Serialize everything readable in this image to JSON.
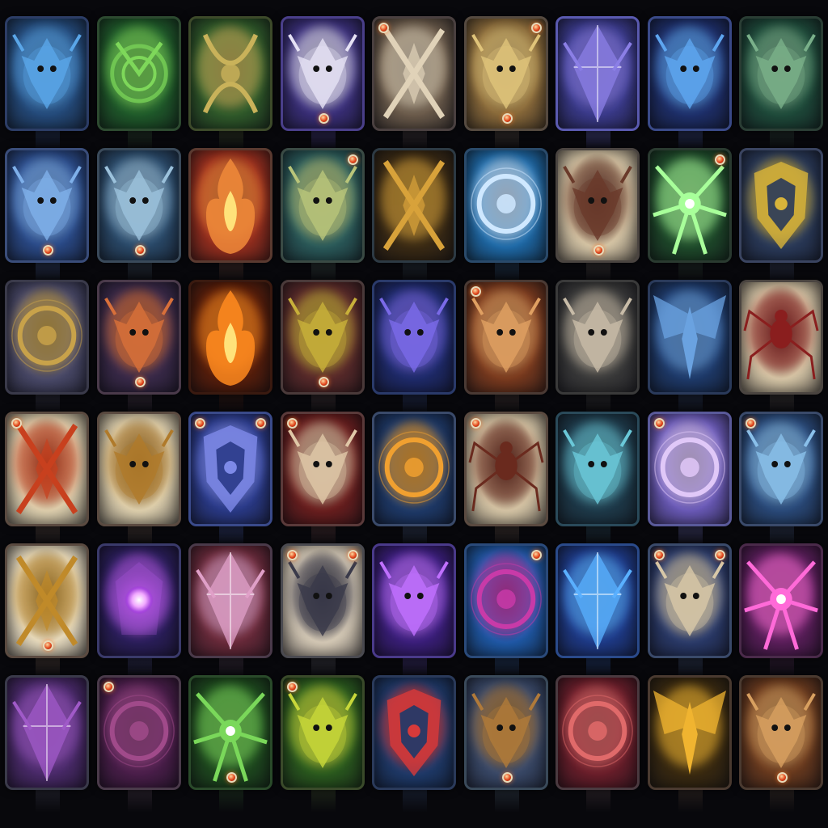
{
  "grid": {
    "columns": 9,
    "rows": 6
  },
  "cards": [
    {
      "bg": "#244a7a",
      "accent": "#5aa6e8",
      "frame": "#2c3d66",
      "motif": "creature",
      "gems": []
    },
    {
      "bg": "#1f5a2a",
      "accent": "#7ed85a",
      "frame": "#2d4a30",
      "motif": "spiral",
      "gems": []
    },
    {
      "bg": "#2f5a2a",
      "accent": "#c9b25a",
      "frame": "#3d4a2a",
      "motif": "bow",
      "gems": []
    },
    {
      "bg": "#3a2f7a",
      "accent": "#e6e2f5",
      "frame": "#4a3f8a",
      "motif": "creature",
      "gems": [
        "bc"
      ]
    },
    {
      "bg": "#6a5a4a",
      "accent": "#e0d2b8",
      "frame": "#4a4040",
      "motif": "blades",
      "gems": [
        "tl"
      ]
    },
    {
      "bg": "#8a6a3a",
      "accent": "#e0c47a",
      "frame": "#554a40",
      "motif": "creature",
      "gems": [
        "tr",
        "bc"
      ]
    },
    {
      "bg": "#3a3a8a",
      "accent": "#8b7fe6",
      "frame": "#5a5ab0",
      "motif": "crystal",
      "gems": []
    },
    {
      "bg": "#1e2f6a",
      "accent": "#5ea6f0",
      "frame": "#3a4a88",
      "motif": "creature",
      "gems": []
    },
    {
      "bg": "#1e4a3a",
      "accent": "#7ab08a",
      "frame": "#2a3d34",
      "motif": "creature",
      "gems": []
    },
    {
      "bg": "#2a4a88",
      "accent": "#7fb0ea",
      "frame": "#3a4d7a",
      "motif": "creature",
      "gems": [
        "bc"
      ]
    },
    {
      "bg": "#2a4a6a",
      "accent": "#9cc2dc",
      "frame": "#3a4a5a",
      "motif": "creature",
      "gems": [
        "bc"
      ]
    },
    {
      "bg": "#9a2f1e",
      "accent": "#f08a3a",
      "frame": "#5a3a30",
      "motif": "flame",
      "gems": []
    },
    {
      "bg": "#2a5a5a",
      "accent": "#b9c57a",
      "frame": "#3a4a44",
      "motif": "creature",
      "gems": [
        "tr"
      ]
    },
    {
      "bg": "#3a2a14",
      "accent": "#d8a23a",
      "frame": "#2d3a44",
      "motif": "blades",
      "gems": []
    },
    {
      "bg": "#1e6aa8",
      "accent": "#cfe8ff",
      "frame": "#2a4a6a",
      "motif": "ring",
      "gems": []
    },
    {
      "bg": "#d8c8a8",
      "accent": "#6a3a2a",
      "frame": "#4a4440",
      "motif": "creature",
      "gems": [
        "bc"
      ]
    },
    {
      "bg": "#1e4a2a",
      "accent": "#a8ff9a",
      "frame": "#2a3a30",
      "motif": "burst",
      "gems": [
        "tr"
      ]
    },
    {
      "bg": "#2a3a5a",
      "accent": "#d8b43a",
      "frame": "#3a4460",
      "motif": "shield",
      "gems": []
    },
    {
      "bg": "#4a4a6a",
      "accent": "#c8a24a",
      "frame": "#3a3a4a",
      "motif": "ring",
      "gems": []
    },
    {
      "bg": "#3a2a4a",
      "accent": "#d8703a",
      "frame": "#4a3a4a",
      "motif": "creature",
      "gems": [
        "bc"
      ]
    },
    {
      "bg": "#5a1e0a",
      "accent": "#ff8a1e",
      "frame": "#3a1a10",
      "motif": "flame",
      "gems": []
    },
    {
      "bg": "#5a2a2a",
      "accent": "#c8b03a",
      "frame": "#4a3a3a",
      "motif": "creature",
      "gems": [
        "bc"
      ]
    },
    {
      "bg": "#1e2a6a",
      "accent": "#7a6ae8",
      "frame": "#2a3a6a",
      "motif": "creature",
      "gems": []
    },
    {
      "bg": "#7a3a1e",
      "accent": "#e0a062",
      "frame": "#4a3a34",
      "motif": "creature",
      "gems": [
        "tl"
      ]
    },
    {
      "bg": "#3a3a3a",
      "accent": "#c8bca8",
      "frame": "#3a3a3a",
      "motif": "creature",
      "gems": []
    },
    {
      "bg": "#1e3a6a",
      "accent": "#6aa2e0",
      "frame": "#2a3a5a",
      "motif": "wings",
      "gems": []
    },
    {
      "bg": "#d8c8a8",
      "accent": "#8a1e1e",
      "frame": "#4a4440",
      "motif": "spider",
      "gems": []
    },
    {
      "bg": "#e0d2b0",
      "accent": "#c8401e",
      "frame": "#5a4a40",
      "motif": "blades",
      "gems": [
        "tl"
      ]
    },
    {
      "bg": "#e0d2b0",
      "accent": "#b07a2a",
      "frame": "#5a4a40",
      "motif": "creature",
      "gems": []
    },
    {
      "bg": "#2a3a88",
      "accent": "#7e8ae8",
      "frame": "#3a4a8a",
      "motif": "shield",
      "gems": [
        "tl",
        "tr"
      ]
    },
    {
      "bg": "#6a1e1e",
      "accent": "#e0c8a8",
      "frame": "#5a3a3a",
      "motif": "creature",
      "gems": [
        "tl"
      ]
    },
    {
      "bg": "#1e3a6a",
      "accent": "#f0a030",
      "frame": "#3a4a6a",
      "motif": "ring",
      "gems": []
    },
    {
      "bg": "#d8c8a8",
      "accent": "#6a2a1e",
      "frame": "#5a4a40",
      "motif": "spider",
      "gems": [
        "tl"
      ]
    },
    {
      "bg": "#1e3a4a",
      "accent": "#6ac8d8",
      "frame": "#2a4a5a",
      "motif": "creature",
      "gems": []
    },
    {
      "bg": "#6a5ab8",
      "accent": "#e0c8f8",
      "frame": "#5a5a9a",
      "motif": "ring",
      "gems": [
        "tl"
      ]
    },
    {
      "bg": "#2a4a7a",
      "accent": "#8ac0ea",
      "frame": "#3a4a6a",
      "motif": "creature",
      "gems": [
        "tl"
      ]
    },
    {
      "bg": "#e8dcc0",
      "accent": "#c08a2a",
      "frame": "#5a4a40",
      "motif": "blades",
      "gems": [
        "bc"
      ]
    },
    {
      "bg": "#2a1e5a",
      "accent": "#b45ae8",
      "frame": "#3a3a6a",
      "motif": "orb",
      "gems": []
    },
    {
      "bg": "#6a2a3a",
      "accent": "#e0a0c8",
      "frame": "#4a3a4a",
      "motif": "crystal",
      "gems": []
    },
    {
      "bg": "#d8ccb8",
      "accent": "#3a3a4a",
      "frame": "#4a4a50",
      "motif": "creature",
      "gems": [
        "tl",
        "tr"
      ]
    },
    {
      "bg": "#3a1e7a",
      "accent": "#c070ff",
      "frame": "#4a3a8a",
      "motif": "creature",
      "gems": []
    },
    {
      "bg": "#1e5aa8",
      "accent": "#c83aa8",
      "frame": "#2a4a7a",
      "motif": "ring",
      "gems": [
        "tr"
      ]
    },
    {
      "bg": "#1e3a88",
      "accent": "#5ab0ff",
      "frame": "#2a4a8a",
      "motif": "crystal",
      "gems": []
    },
    {
      "bg": "#2a3a6a",
      "accent": "#d8c8a8",
      "frame": "#3a4a6a",
      "motif": "creature",
      "gems": [
        "tr",
        "tl"
      ]
    },
    {
      "bg": "#5a1e5a",
      "accent": "#ff6ad8",
      "frame": "#4a2a4a",
      "motif": "burst",
      "gems": []
    },
    {
      "bg": "#4a2a6a",
      "accent": "#a05ac8",
      "frame": "#3a3a4a",
      "motif": "crystal",
      "gems": []
    },
    {
      "bg": "#4a1e4a",
      "accent": "#a04a8a",
      "frame": "#4a3a4a",
      "motif": "ring",
      "gems": [
        "tl"
      ]
    },
    {
      "bg": "#1e4a1e",
      "accent": "#7ad85a",
      "frame": "#2a4a2a",
      "motif": "burst",
      "gems": [
        "bc"
      ]
    },
    {
      "bg": "#2a5a1e",
      "accent": "#c8d83a",
      "frame": "#3a4a2a",
      "motif": "creature",
      "gems": [
        "tl"
      ]
    },
    {
      "bg": "#1e3a6a",
      "accent": "#d83a3a",
      "frame": "#2a3a5a",
      "motif": "shield",
      "gems": []
    },
    {
      "bg": "#3a4a6a",
      "accent": "#b07a3a",
      "frame": "#3a4a5a",
      "motif": "creature",
      "gems": [
        "bc"
      ]
    },
    {
      "bg": "#6a1e2a",
      "accent": "#e06a6a",
      "frame": "#4a3a40",
      "motif": "ring",
      "gems": []
    },
    {
      "bg": "#3a2a10",
      "accent": "#f0b430",
      "frame": "#4a3a30",
      "motif": "wings",
      "gems": []
    },
    {
      "bg": "#6a3a1e",
      "accent": "#d8a060",
      "frame": "#4a3a30",
      "motif": "creature",
      "gems": [
        "bc"
      ]
    }
  ]
}
